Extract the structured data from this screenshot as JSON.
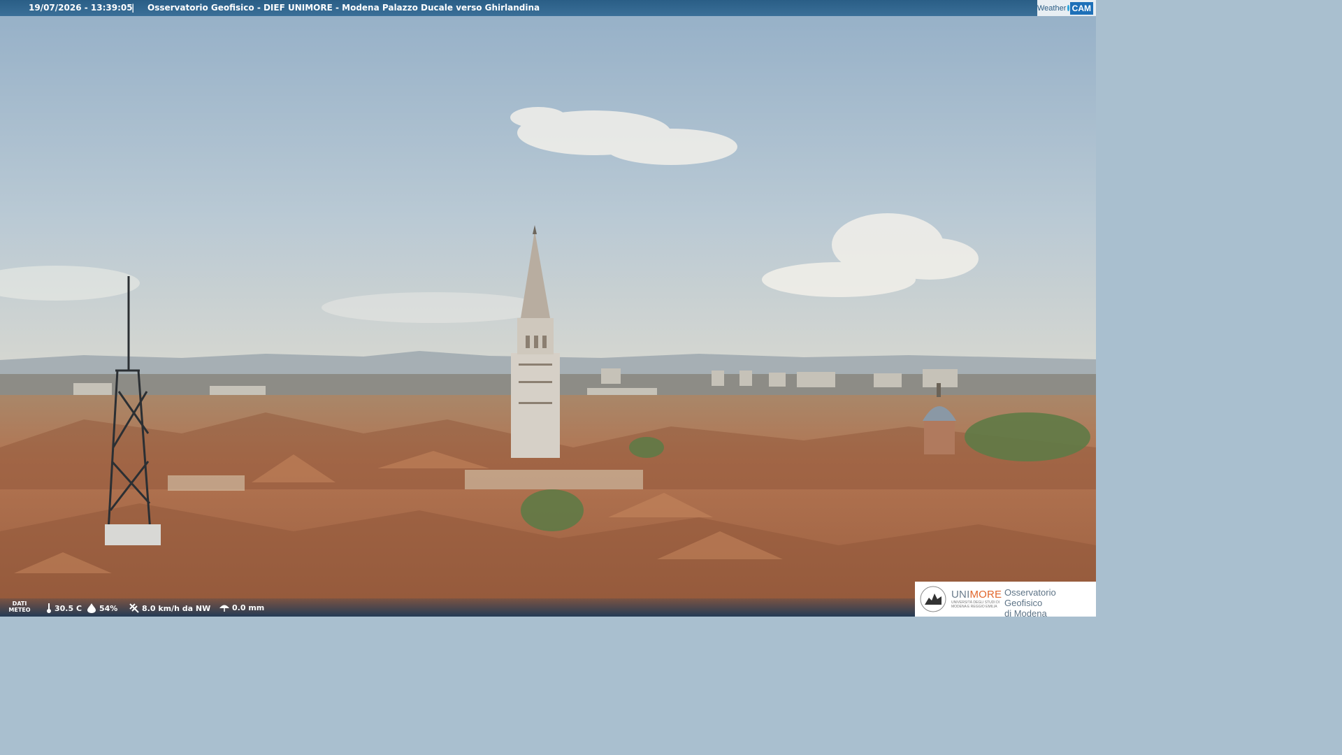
{
  "overlay": {
    "timestamp": "19/07/2026 - 13:39:05",
    "separator": "|",
    "location": "Osservatorio Geofisico - DIEF UNIMORE - Modena Palazzo Ducale verso Ghirlandina",
    "logo": {
      "weather": "Weather",
      "cam": "CAM"
    }
  },
  "weather": {
    "label": "DATI METEO",
    "temperature": "30.5 C",
    "humidity": "54%",
    "wind": "8.0 km/h da NW",
    "rain": "0.0 mm"
  },
  "institution": {
    "brand_a": "UNI",
    "brand_b": "MORE",
    "subtitle": "UNIVERSITÀ DEGLI STUDI DI MODENA E REGGIO EMILIA",
    "observatory_line1": "Osservatorio Geofisico",
    "observatory_line2": "di Modena"
  },
  "colors": {
    "sky_top": "#9fb8cd",
    "sky_horizon": "#d5dcdd",
    "roof": "#b8754f",
    "tower": "#d9d2c8",
    "bar": "#2a5e86",
    "brand_orange": "#e2662b"
  }
}
